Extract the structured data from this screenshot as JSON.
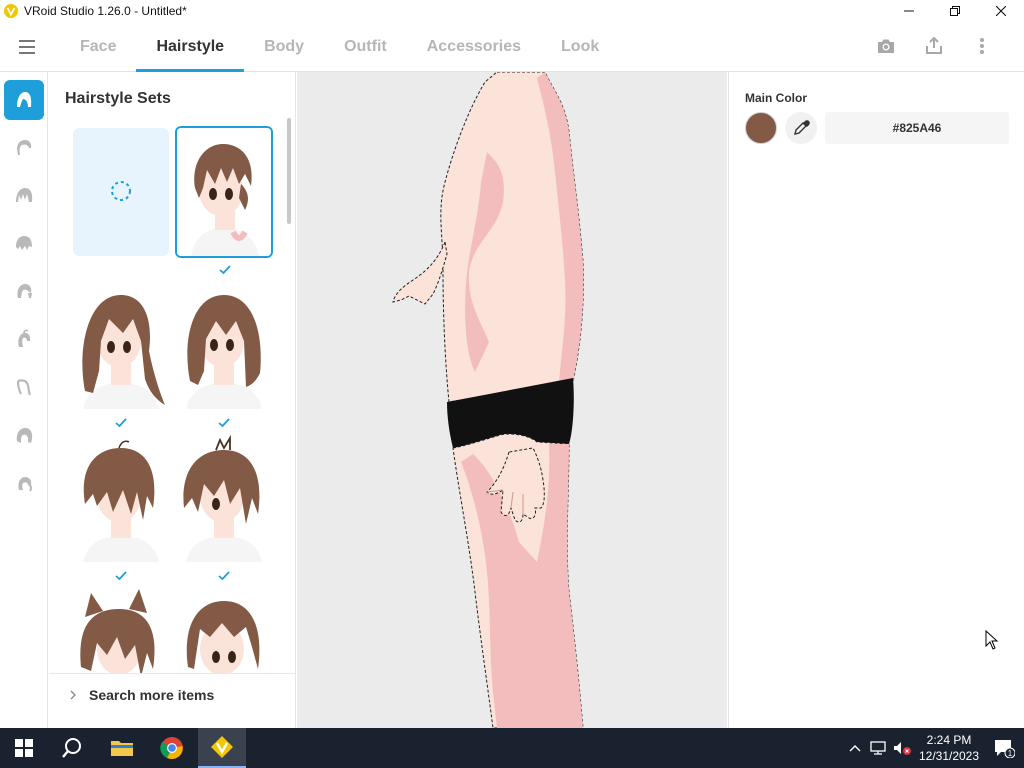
{
  "window": {
    "title": "VRoid Studio 1.26.0 - Untitled*"
  },
  "nav": {
    "tabs": [
      {
        "label": "Face"
      },
      {
        "label": "Hairstyle"
      },
      {
        "label": "Body"
      },
      {
        "label": "Outfit"
      },
      {
        "label": "Accessories"
      },
      {
        "label": "Look"
      }
    ],
    "active_tab": "Hairstyle"
  },
  "sidebar": {
    "items": [
      {
        "icon": "hairstyle-set-icon",
        "active": true
      },
      {
        "icon": "base-hair-icon"
      },
      {
        "icon": "front-hair-icon"
      },
      {
        "icon": "back-hair-icon"
      },
      {
        "icon": "side-hair-icon"
      },
      {
        "icon": "ahoge-icon"
      },
      {
        "icon": "strand-hair-icon"
      },
      {
        "icon": "hair-extension-icon"
      },
      {
        "icon": "ponytail-hair-icon"
      }
    ]
  },
  "panel": {
    "title": "Hairstyle Sets",
    "search_more": "Search more items",
    "cards": [
      {
        "kind": "new",
        "checked": false
      },
      {
        "kind": "short-hair",
        "selected": true,
        "checked": true
      },
      {
        "kind": "long-hair",
        "checked": true
      },
      {
        "kind": "medium-bob",
        "checked": true
      },
      {
        "kind": "messy-short",
        "checked": true
      },
      {
        "kind": "spiky-bob",
        "checked": true
      },
      {
        "kind": "cat-ears-bun",
        "checked": false
      },
      {
        "kind": "straight-bob",
        "checked": false
      }
    ]
  },
  "properties": {
    "main_color_label": "Main Color",
    "main_color_hex": "#825A46"
  },
  "taskbar": {
    "time": "2:24 PM",
    "date": "12/31/2023",
    "notification_count": "1"
  },
  "colors": {
    "accent": "#1E9FD9",
    "hair": "#825A46",
    "skin": "#FBE3DA",
    "skin_shadow": "#F4BDBD",
    "taskbar": "#1A2230"
  }
}
